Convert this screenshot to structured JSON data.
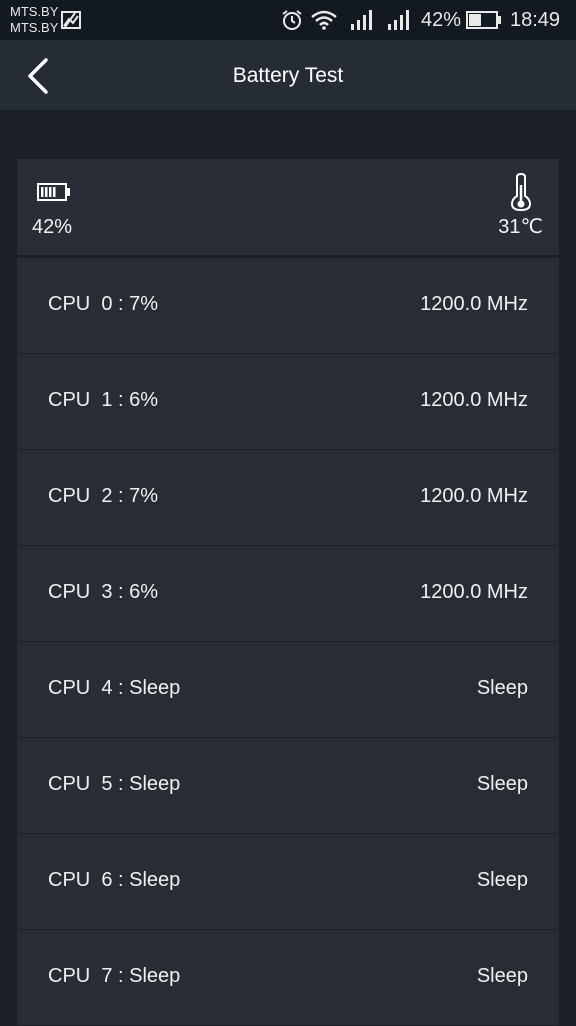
{
  "status_bar": {
    "carrier_1": "MTS.BY",
    "carrier_2": "MTS.BY",
    "battery_percent": "42%",
    "time": "18:49",
    "icons": [
      "gallery-icon",
      "alarm-icon",
      "wifi-icon",
      "signal-icon",
      "signal-icon",
      "battery-icon"
    ]
  },
  "header": {
    "title": "Battery Test",
    "back_icon": "chevron-left-icon"
  },
  "summary": {
    "battery": "42%",
    "battery_icon": "battery-icon",
    "temperature": "31℃",
    "temperature_icon": "thermometer-icon"
  },
  "cpus": [
    {
      "label": "CPU  0 : 7%",
      "freq": "1200.0 MHz"
    },
    {
      "label": "CPU  1 : 6%",
      "freq": "1200.0 MHz"
    },
    {
      "label": "CPU  2 : 7%",
      "freq": "1200.0 MHz"
    },
    {
      "label": "CPU  3 : 6%",
      "freq": "1200.0 MHz"
    },
    {
      "label": "CPU  4 : Sleep",
      "freq": "Sleep"
    },
    {
      "label": "CPU  5 : Sleep",
      "freq": "Sleep"
    },
    {
      "label": "CPU  6 : Sleep",
      "freq": "Sleep"
    },
    {
      "label": "CPU  7 : Sleep",
      "freq": "Sleep"
    }
  ],
  "colors": {
    "background": "#1b1f26",
    "header": "#262c36",
    "card": "#282d36",
    "text": "#ffffff"
  }
}
